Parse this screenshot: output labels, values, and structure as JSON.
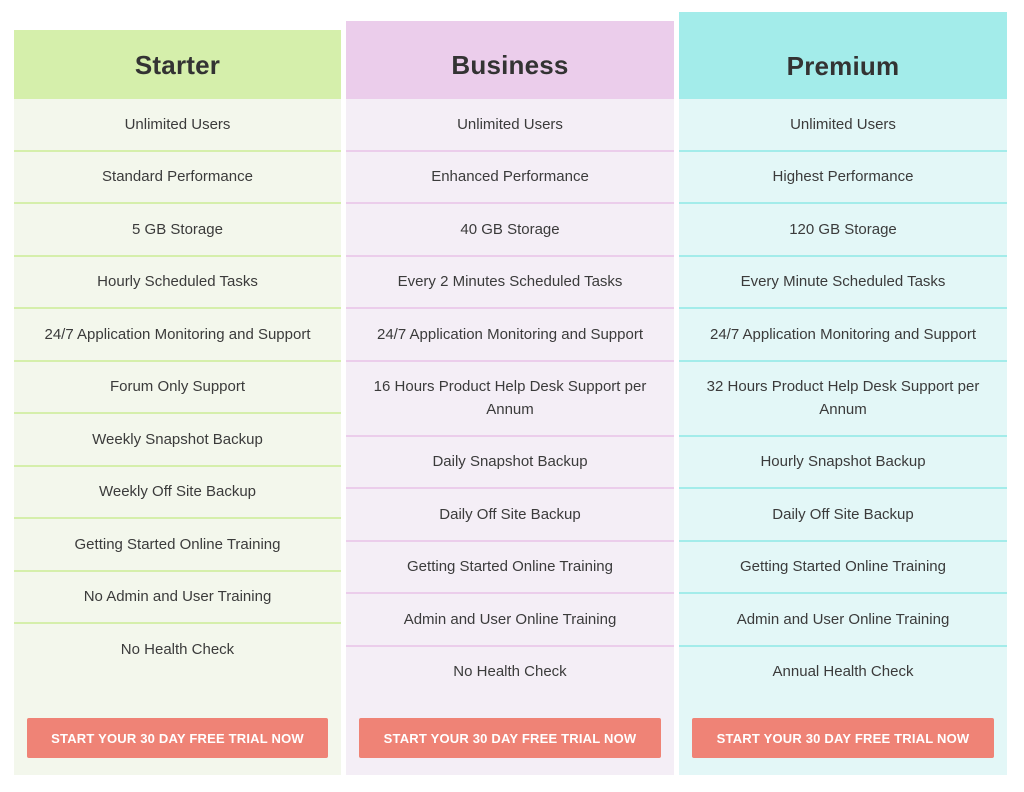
{
  "plans": [
    {
      "name": "Starter",
      "header_color": "#d5efab",
      "features": [
        "Unlimited Users",
        "Standard Performance",
        "5 GB Storage",
        "Hourly Scheduled Tasks",
        "24/7 Application Monitoring and Support",
        "Forum Only Support",
        "Weekly Snapshot Backup",
        "Weekly Off Site Backup",
        "Getting Started Online Training",
        "No Admin and User Training",
        "No Health Check"
      ],
      "cta_label": "START YOUR 30 DAY FREE TRIAL NOW"
    },
    {
      "name": "Business",
      "header_color": "#ebcdeb",
      "features": [
        "Unlimited Users",
        "Enhanced Performance",
        "40 GB Storage",
        "Every 2 Minutes Scheduled Tasks",
        "24/7 Application Monitoring and Support",
        "16 Hours Product Help Desk Support per Annum",
        "Daily Snapshot Backup",
        "Daily Off Site Backup",
        "Getting Started Online Training",
        "Admin and User Online Training",
        "No Health Check"
      ],
      "cta_label": "START YOUR 30 DAY FREE TRIAL NOW"
    },
    {
      "name": "Premium",
      "header_color": "#a3ecea",
      "features": [
        "Unlimited Users",
        "Highest Performance",
        "120 GB Storage",
        "Every Minute Scheduled Tasks",
        "24/7 Application Monitoring and Support",
        "32 Hours Product Help Desk Support per Annum",
        "Hourly Snapshot Backup",
        "Daily Off Site Backup",
        "Getting Started Online Training",
        "Admin and User Online Training",
        "Annual Health Check"
      ],
      "cta_label": "START YOUR 30 DAY FREE TRIAL NOW"
    }
  ],
  "cta_color": "#ef8376"
}
